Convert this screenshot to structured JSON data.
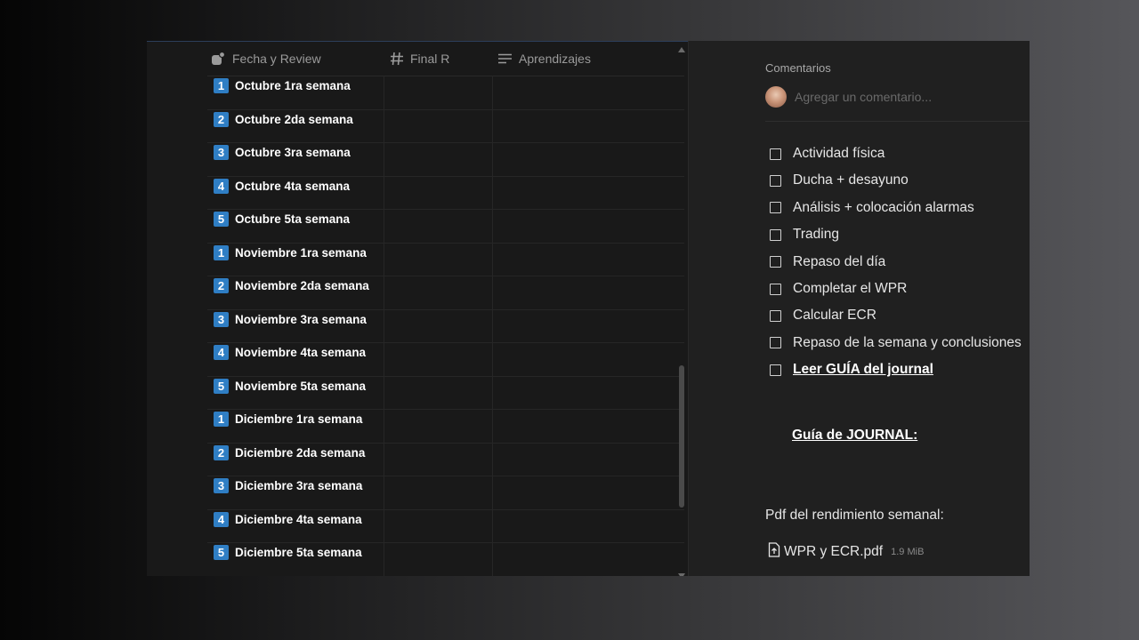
{
  "table": {
    "columns": [
      {
        "label": "Fecha y Review",
        "icon": "review-icon"
      },
      {
        "label": "Final R",
        "icon": "number-icon"
      },
      {
        "label": "Aprendizajes",
        "icon": "text-icon"
      }
    ],
    "rows": [
      {
        "badge": "1",
        "title": "Octubre 1ra semana"
      },
      {
        "badge": "2",
        "title": "Octubre 2da semana"
      },
      {
        "badge": "3",
        "title": "Octubre 3ra semana"
      },
      {
        "badge": "4",
        "title": "Octubre 4ta semana"
      },
      {
        "badge": "5",
        "title": "Octubre 5ta semana"
      },
      {
        "badge": "1",
        "title": "Noviembre 1ra semana"
      },
      {
        "badge": "2",
        "title": "Noviembre 2da semana"
      },
      {
        "badge": "3",
        "title": "Noviembre 3ra semana"
      },
      {
        "badge": "4",
        "title": "Noviembre 4ta semana"
      },
      {
        "badge": "5",
        "title": "Noviembre 5ta semana"
      },
      {
        "badge": "1",
        "title": "Diciembre 1ra semana"
      },
      {
        "badge": "2",
        "title": "Diciembre 2da semana"
      },
      {
        "badge": "3",
        "title": "Diciembre 3ra semana"
      },
      {
        "badge": "4",
        "title": "Diciembre 4ta semana"
      },
      {
        "badge": "5",
        "title": "Diciembre 5ta semana"
      }
    ]
  },
  "comments": {
    "title": "Comentarios",
    "placeholder": "Agregar un comentario..."
  },
  "todos": [
    {
      "label": "Actividad física",
      "checked": false
    },
    {
      "label": "Ducha + desayuno",
      "checked": false
    },
    {
      "label": "Análisis + colocación alarmas",
      "checked": false
    },
    {
      "label": "Trading",
      "checked": false
    },
    {
      "label": "Repaso del día",
      "checked": false
    },
    {
      "label": "Completar el WPR",
      "checked": false
    },
    {
      "label": "Calcular ECR",
      "checked": false
    },
    {
      "label": "Repaso de la semana y conclusiones",
      "checked": false
    },
    {
      "label": "Leer GUÍA del journal",
      "checked": false
    }
  ],
  "guide": {
    "label": "Guía de JOURNAL:"
  },
  "pdf": {
    "label": "Pdf del rendimiento semanal:",
    "file_name": "WPR y ECR.pdf",
    "file_size": "1.9 MiB"
  },
  "colors": {
    "badge": "#2f7ec4",
    "background": "#191919",
    "panel": "#202020"
  }
}
